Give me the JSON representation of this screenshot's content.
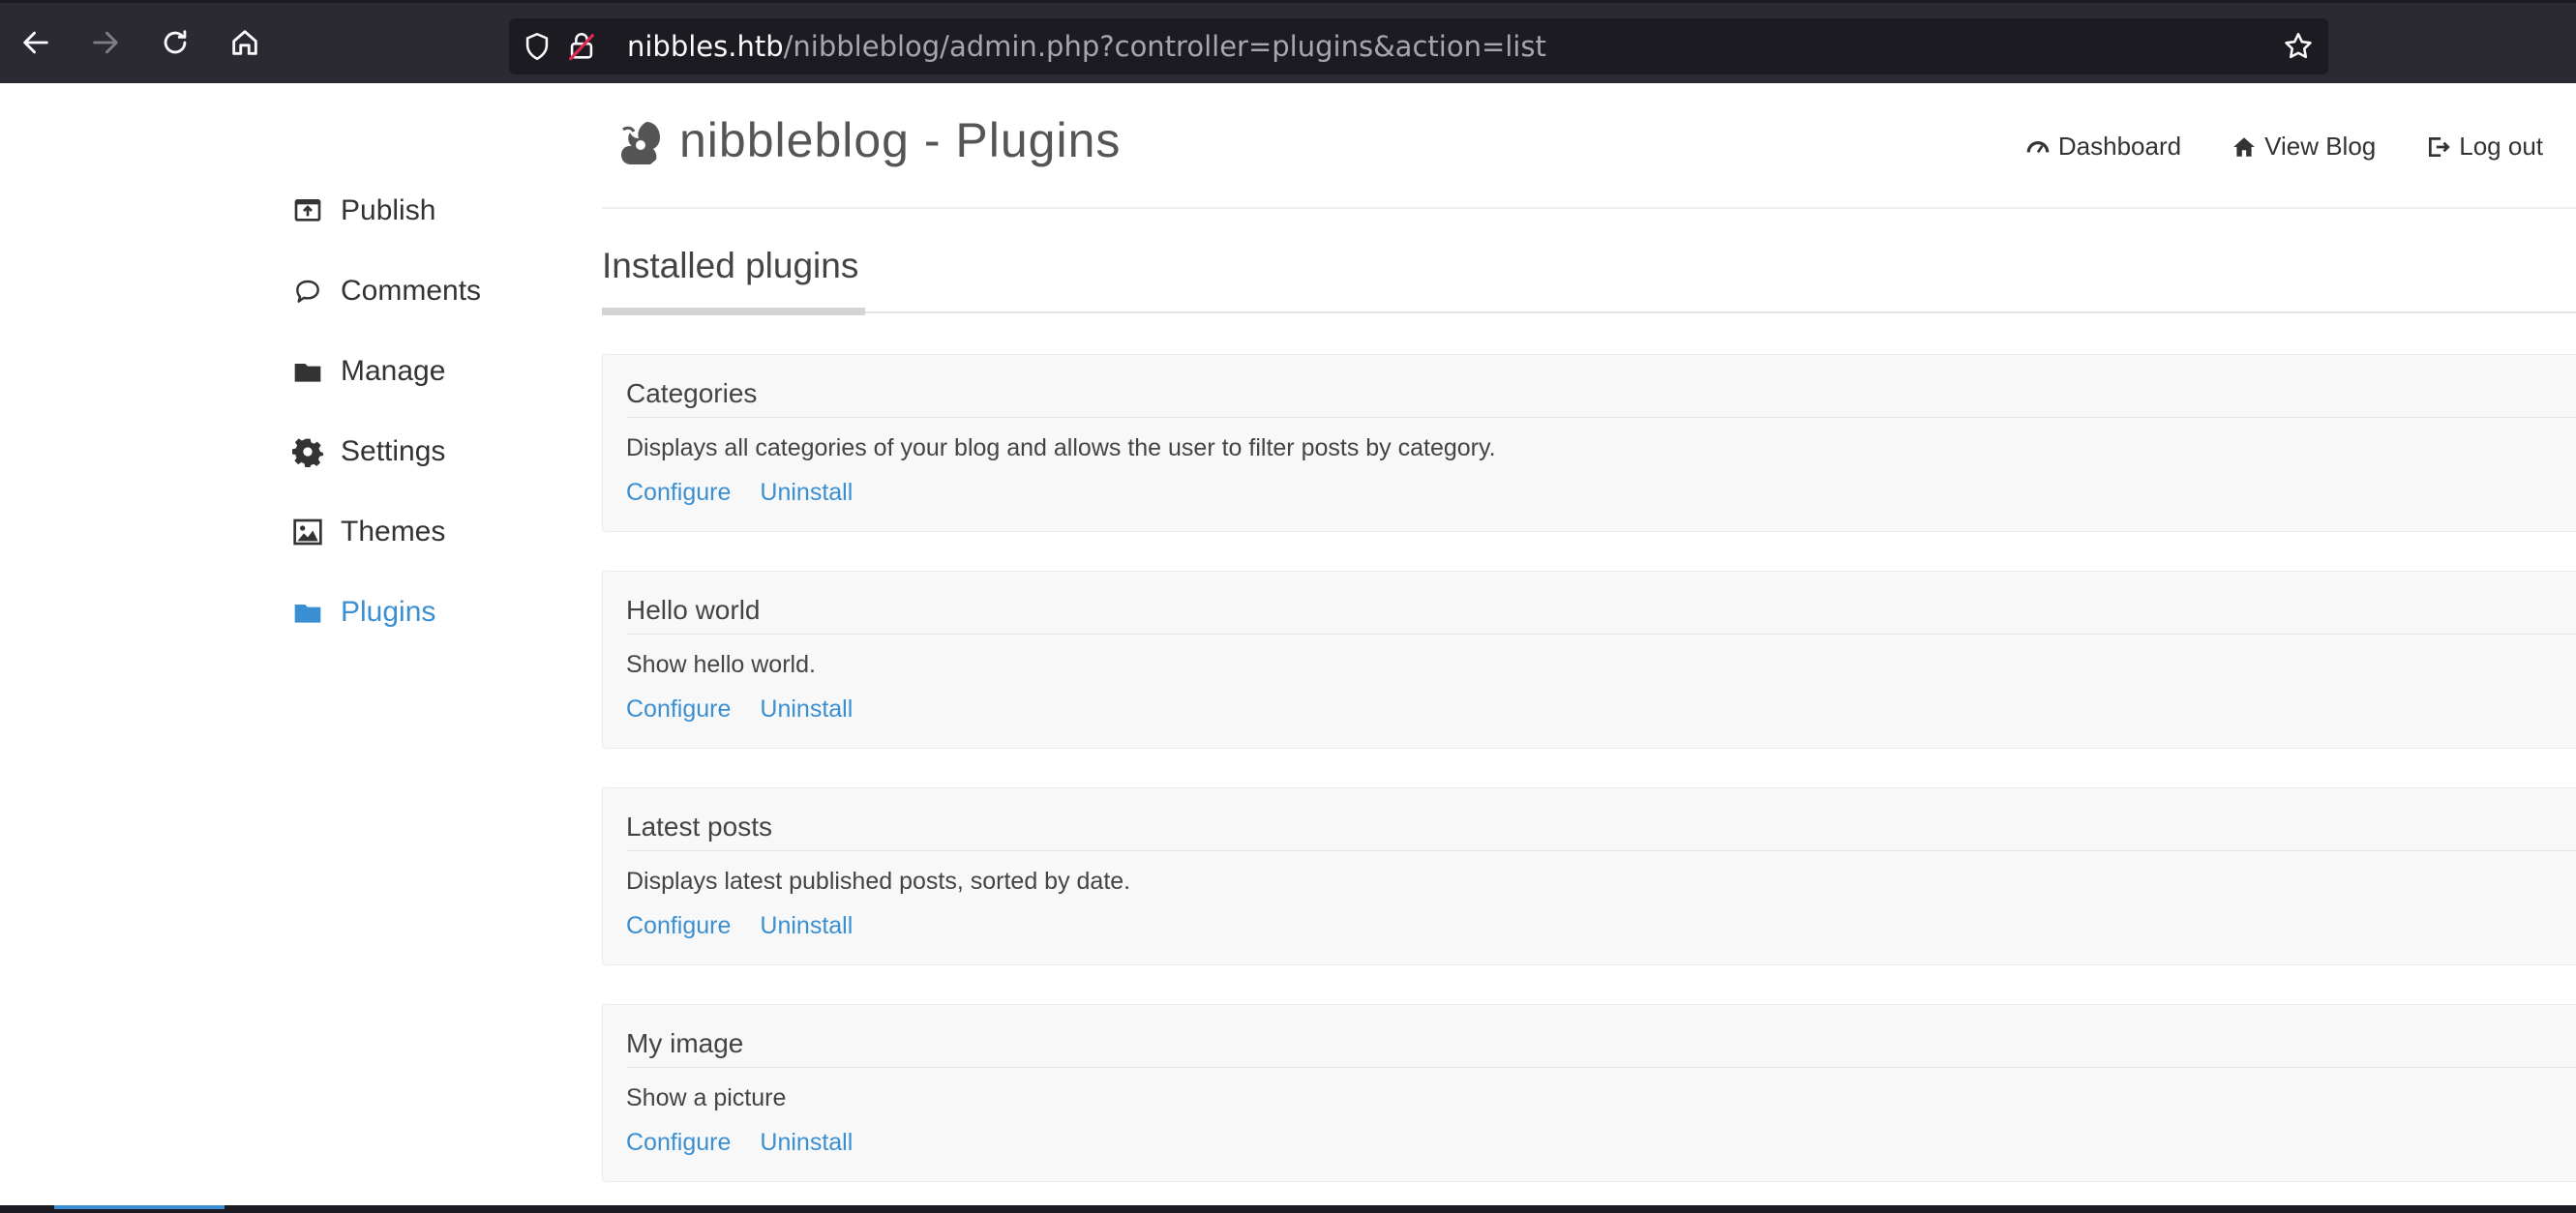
{
  "browser": {
    "url_host": "nibbles.htb",
    "url_path": "/nibbleblog/admin.php?controller=plugins&action=list"
  },
  "header": {
    "title": "nibbleblog - Plugins",
    "links": [
      {
        "label": "Dashboard",
        "icon": "dashboard-icon"
      },
      {
        "label": "View Blog",
        "icon": "home-icon"
      },
      {
        "label": "Log out",
        "icon": "logout-icon"
      }
    ]
  },
  "sidebar": {
    "items": [
      {
        "label": "Publish",
        "icon": "publish-icon"
      },
      {
        "label": "Comments",
        "icon": "comment-icon"
      },
      {
        "label": "Manage",
        "icon": "folder-icon"
      },
      {
        "label": "Settings",
        "icon": "gear-icon"
      },
      {
        "label": "Themes",
        "icon": "image-icon"
      },
      {
        "label": "Plugins",
        "icon": "folder-open-icon",
        "active": true
      }
    ]
  },
  "main": {
    "section_title": "Installed plugins",
    "plugins": [
      {
        "name": "Categories",
        "description": "Displays all categories of your blog and allows the user to filter posts by category.",
        "configure": "Configure",
        "uninstall": "Uninstall"
      },
      {
        "name": "Hello world",
        "description": "Show hello world.",
        "configure": "Configure",
        "uninstall": "Uninstall"
      },
      {
        "name": "Latest posts",
        "description": "Displays latest published posts, sorted by date.",
        "configure": "Configure",
        "uninstall": "Uninstall"
      },
      {
        "name": "My image",
        "description": "Show a picture",
        "configure": "Configure",
        "uninstall": "Uninstall"
      }
    ]
  },
  "colors": {
    "accent": "#3a8fd3",
    "chrome": "#2b2a33",
    "text": "#333333"
  }
}
